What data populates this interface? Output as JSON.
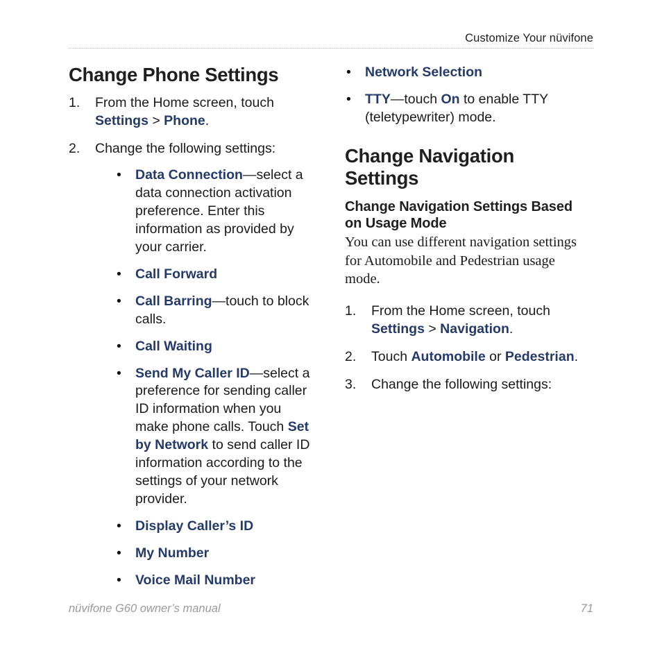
{
  "header": {
    "running_head": "Customize Your nüvifone"
  },
  "left_column": {
    "title": "Change Phone Settings",
    "steps": [
      {
        "number": "1.",
        "parts": [
          {
            "text": "From the Home screen, touch ",
            "style": "normal"
          },
          {
            "text": "Settings",
            "style": "term"
          },
          {
            "text": " > ",
            "style": "normal"
          },
          {
            "text": "Phone",
            "style": "term"
          },
          {
            "text": ".",
            "style": "normal"
          }
        ]
      },
      {
        "number": "2.",
        "parts": [
          {
            "text": "Change the following settings:",
            "style": "normal"
          }
        ],
        "bullets": [
          [
            {
              "text": "Data Connection",
              "style": "term"
            },
            {
              "text": "—select a data connection activation preference. Enter this information as provided by your carrier.",
              "style": "normal"
            }
          ],
          [
            {
              "text": "Call Forward",
              "style": "term"
            }
          ],
          [
            {
              "text": "Call Barring",
              "style": "term"
            },
            {
              "text": "—touch to block calls.",
              "style": "normal"
            }
          ],
          [
            {
              "text": "Call Waiting",
              "style": "term"
            }
          ],
          [
            {
              "text": "Send My Caller ID",
              "style": "term"
            },
            {
              "text": "—select a preference for sending caller ID information when you make phone calls. Touch ",
              "style": "normal"
            },
            {
              "text": "Set by Network",
              "style": "term"
            },
            {
              "text": " to send caller ID information according to the settings of your network provider.",
              "style": "normal"
            }
          ],
          [
            {
              "text": "Display Caller’s ID",
              "style": "term"
            }
          ],
          [
            {
              "text": "My Number",
              "style": "term"
            }
          ],
          [
            {
              "text": "Voice Mail Number",
              "style": "term"
            }
          ]
        ]
      }
    ]
  },
  "right_column": {
    "continued_bullets": [
      [
        {
          "text": "Network Selection",
          "style": "term"
        }
      ],
      [
        {
          "text": "TTY",
          "style": "term"
        },
        {
          "text": "—touch ",
          "style": "normal"
        },
        {
          "text": "On",
          "style": "term"
        },
        {
          "text": " to enable TTY (teletypewriter) mode.",
          "style": "normal"
        }
      ]
    ],
    "title": "Change Navigation Settings",
    "subtitle": "Change Navigation Settings Based on Usage Mode",
    "intro": "You can use different navigation settings for Automobile and Pedestrian usage mode.",
    "steps": [
      {
        "number": "1.",
        "parts": [
          {
            "text": "From the Home screen, touch ",
            "style": "normal"
          },
          {
            "text": "Settings",
            "style": "term"
          },
          {
            "text": " > ",
            "style": "normal"
          },
          {
            "text": "Navigation",
            "style": "term"
          },
          {
            "text": ".",
            "style": "normal"
          }
        ]
      },
      {
        "number": "2.",
        "parts": [
          {
            "text": "Touch ",
            "style": "normal"
          },
          {
            "text": "Automobile",
            "style": "term"
          },
          {
            "text": " or ",
            "style": "normal"
          },
          {
            "text": "Pedestrian",
            "style": "term"
          },
          {
            "text": ".",
            "style": "normal"
          }
        ]
      },
      {
        "number": "3.",
        "parts": [
          {
            "text": "Change the following settings:",
            "style": "normal"
          }
        ]
      }
    ]
  },
  "footer": {
    "manual": "nüvifone G60 owner’s manual",
    "page_number": "71"
  },
  "bullet_glyph": "•",
  "colors": {
    "term_blue": "#253a69",
    "body_text": "#1a1a1a",
    "footer_gray": "#9a9a9a",
    "rule_gray": "#c4c4c4"
  }
}
